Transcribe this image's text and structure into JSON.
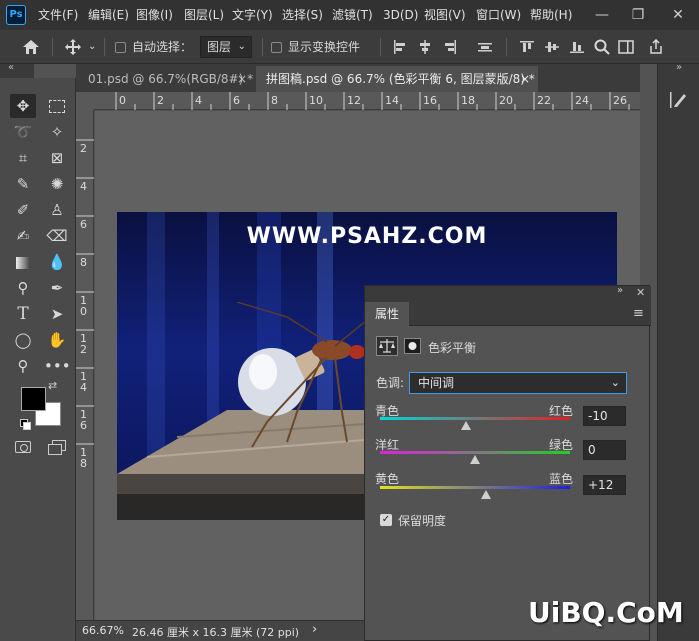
{
  "menubar": {
    "logo": "Ps",
    "items": [
      "文件(F)",
      "编辑(E)",
      "图像(I)",
      "图层(L)",
      "文字(Y)",
      "选择(S)",
      "滤镜(T)",
      "3D(D)",
      "视图(V)",
      "窗口(W)",
      "帮助(H)"
    ],
    "controls": [
      "—",
      "❐",
      "✕"
    ]
  },
  "options": {
    "auto_select_label": "自动选择：",
    "layer_select_value": "图层",
    "show_transform_label": "显示变换控件"
  },
  "tabs": [
    {
      "label": "01.psd @ 66.7%(RGB/8#) *",
      "close": "×"
    },
    {
      "label": "拼图稿.psd @ 66.7% (色彩平衡 6, 图层蒙版/8) *",
      "close": "×"
    }
  ],
  "ruler": {
    "top": [
      "0",
      "2",
      "4",
      "6",
      "8",
      "10",
      "12",
      "14",
      "16",
      "18",
      "20",
      "22",
      "24",
      "26"
    ],
    "left": [
      "2",
      "4",
      "6",
      "8",
      "1\n0",
      "1\n2",
      "1\n4",
      "1\n6",
      "1\n8"
    ]
  },
  "canvas": {
    "watermark": "WWW.PSAHZ.COM"
  },
  "status": {
    "zoom": "66.67%",
    "doc_size": "26.46 厘米 x 16.3 厘米 (72 ppi)",
    "arrow": "›"
  },
  "properties": {
    "tab_label": "属性",
    "adjustment_title": "色彩平衡",
    "tone_label": "色调:",
    "tone_value": "中间调",
    "sliders": [
      {
        "left": "青色",
        "right": "红色",
        "value": "-10",
        "position": 0.45
      },
      {
        "left": "洋红",
        "right": "绿色",
        "value": "0",
        "position": 0.5
      },
      {
        "left": "黄色",
        "right": "蓝色",
        "value": "+12",
        "position": 0.56
      }
    ],
    "preserve_label": "保留明度",
    "preserve_checked": true
  },
  "brand_watermark": "UiBQ.CoM",
  "colors": {
    "foreground": "#000000",
    "background": "#ffffff",
    "accent": "#3f9bf0"
  }
}
